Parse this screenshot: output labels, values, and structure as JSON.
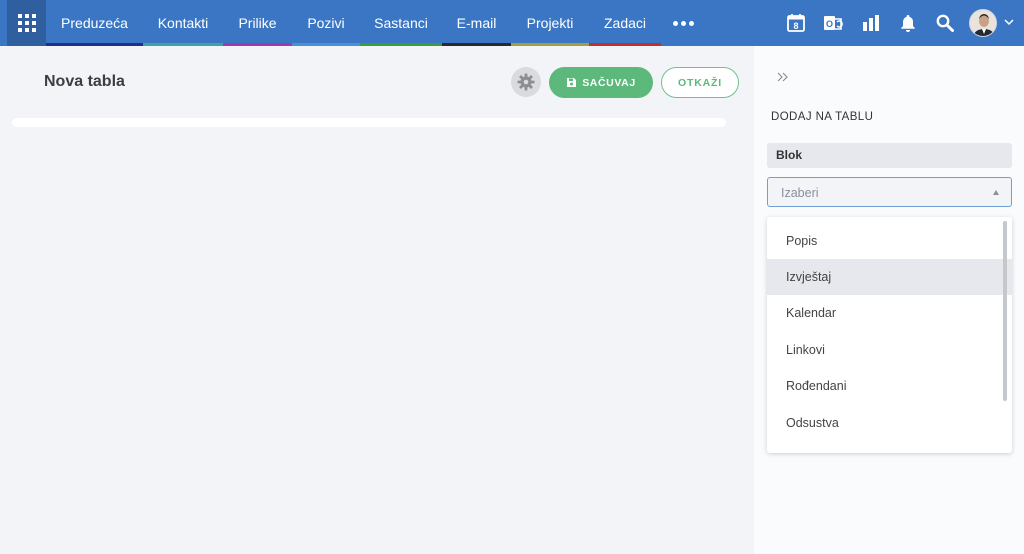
{
  "nav": {
    "items": [
      {
        "label": "Preduzeća",
        "accent": "#1e2f8c"
      },
      {
        "label": "Kontakti",
        "accent": "#3fa3a3"
      },
      {
        "label": "Prilike",
        "accent": "#9a3bb0"
      },
      {
        "label": "Pozivi",
        "accent": "#4a90d9"
      },
      {
        "label": "Sastanci",
        "accent": "#3a9c3a"
      },
      {
        "label": "E-mail",
        "accent": "#2a2a2a"
      },
      {
        "label": "Projekti",
        "accent": "#a3a03a"
      },
      {
        "label": "Zadaci",
        "accent": "#c03030"
      }
    ],
    "more_icon": "more-horizontal-icon",
    "calendar_day": "8",
    "right_icons": [
      "calendar-icon",
      "outlook-sync-icon",
      "bar-chart-icon",
      "bell-icon",
      "search-icon"
    ],
    "colors": {
      "bar": "#3b76c4",
      "apps_button": "#2f5f9f"
    }
  },
  "main": {
    "title": "Nova tabla",
    "save_label": "SAČUVAJ",
    "cancel_label": "OTKAŽI",
    "colors": {
      "save": "#5cb87b",
      "gear": "#d9dbdf"
    }
  },
  "side": {
    "title": "DODAJ NA TABLU",
    "block_label": "Blok",
    "select": {
      "placeholder": "Izaberi"
    },
    "options": [
      "Popis",
      "Izvještaj",
      "Kalendar",
      "Linkovi",
      "Rođendani",
      "Odsustva"
    ],
    "highlighted_option": "Izvještaj",
    "colors": {
      "select_border": "#6f9fd6",
      "highlight": "#e6e8ed"
    }
  }
}
